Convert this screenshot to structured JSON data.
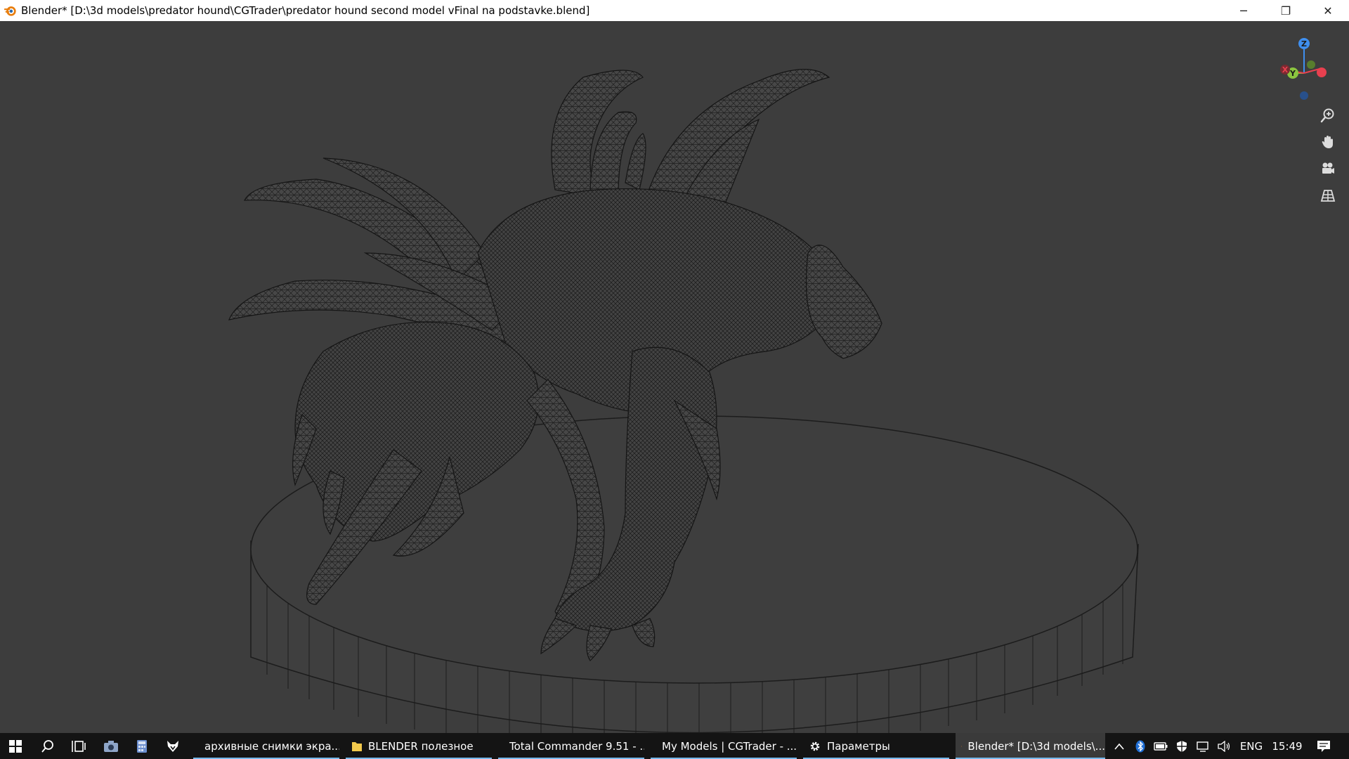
{
  "window": {
    "title": "Blender* [D:\\3d models\\predator hound\\CGTrader\\predator hound second model vFinal na podstavke.blend]",
    "minimize": "─",
    "restore": "❐",
    "close": "✕"
  },
  "gizmo": {
    "z": "Z",
    "y": "Y",
    "x": "X"
  },
  "taskbar": {
    "apps": [
      {
        "label": "архивные снимки экра...",
        "icon": "folder-icon"
      },
      {
        "label": "BLENDER полезное",
        "icon": "folder-icon"
      },
      {
        "label": "Total Commander 9.51 - ...",
        "icon": "total-commander-icon"
      },
      {
        "label": "My Models | CGTrader - ...",
        "icon": "chrome-icon"
      },
      {
        "label": "Параметры",
        "icon": "gear-icon"
      },
      {
        "label": "Blender* [D:\\3d models\\...",
        "icon": "blender-icon"
      }
    ],
    "tray": {
      "language": "ENG",
      "time": "15:49"
    }
  },
  "colors": {
    "viewport_bg": "#3d3d3d",
    "taskbar_bg": "#141414",
    "axis_x": "#e8404f",
    "axis_y": "#8bc43f",
    "axis_z": "#3f8fef",
    "accent": "#76b9ed"
  }
}
